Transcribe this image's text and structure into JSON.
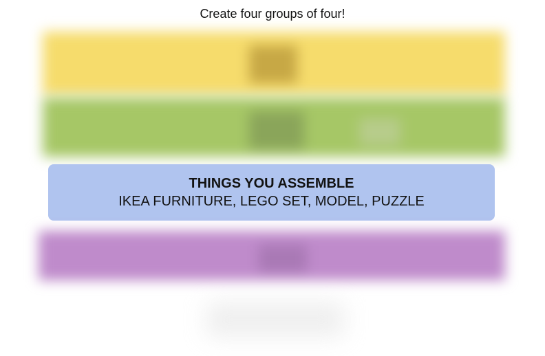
{
  "header": {
    "instructions": "Create four groups of four!"
  },
  "solved_groups": [
    {
      "title": "THINGS YOU ASSEMBLE",
      "members": "IKEA FURNITURE, LEGO SET, MODEL, PUZZLE",
      "color": "#b0c4ef"
    }
  ],
  "obscured_rows": {
    "yellow": "#f9df6d",
    "green": "#a0c35a",
    "purple": "#ba81c5"
  }
}
